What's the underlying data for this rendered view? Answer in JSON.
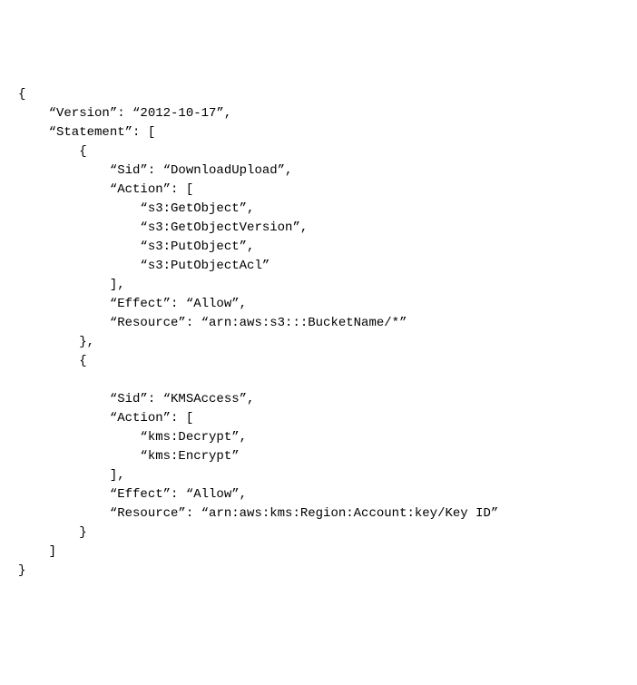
{
  "policy": {
    "open_brace": "{",
    "version_line": "    “Version”: “2012-10-17”,",
    "statement_open": "    “Statement”: [",
    "stmt1_open": "        {",
    "stmt1_sid": "            “Sid”: “DownloadUpload”,",
    "stmt1_action_open": "            “Action”: [",
    "stmt1_action1": "                “s3:GetObject”,",
    "stmt1_action2": "                “s3:GetObjectVersion”,",
    "stmt1_action3": "                “s3:PutObject”,",
    "stmt1_action4": "                “s3:PutObjectAcl”",
    "stmt1_action_close": "            ],",
    "stmt1_effect": "            “Effect”: “Allow”,",
    "stmt1_resource": "            “Resource”: “arn:aws:s3:::BucketName/*”",
    "stmt1_close": "        },",
    "stmt2_open": "        {",
    "stmt2_blank": "",
    "stmt2_sid": "            “Sid”: “KMSAccess”,",
    "stmt2_action_open": "            “Action”: [",
    "stmt2_action1": "                “kms:Decrypt”,",
    "stmt2_action2": "                “kms:Encrypt”",
    "stmt2_action_close": "            ],",
    "stmt2_effect": "            “Effect”: “Allow”,",
    "stmt2_resource": "            “Resource”: “arn:aws:kms:Region:Account:key/Key ID”",
    "stmt2_close": "        }",
    "statement_close": "    ]",
    "close_brace": "}"
  }
}
